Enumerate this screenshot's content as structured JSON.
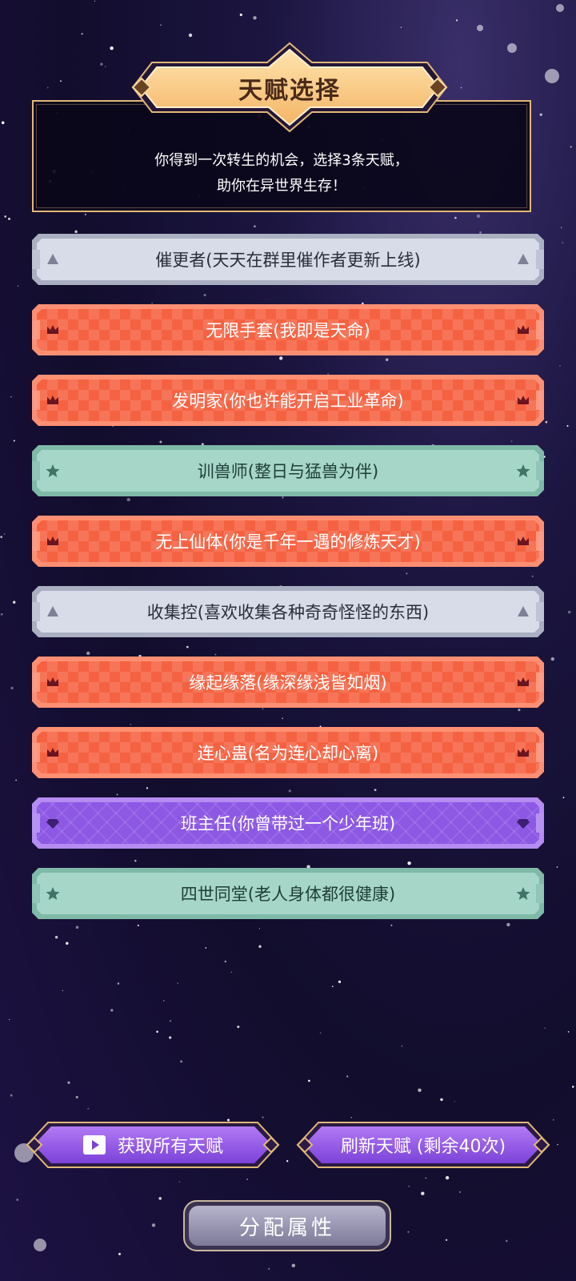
{
  "header": {
    "title": "天赋选择",
    "description_line1": "你得到一次转生的机会，选择3条天赋，",
    "description_line2": "助你在异世界生存！"
  },
  "talents": [
    {
      "label": "催更者(天天在群里催作者更新上线)",
      "rarity": "gray",
      "icon": "triangle-icon"
    },
    {
      "label": "无限手套(我即是天命)",
      "rarity": "red",
      "icon": "crown-icon"
    },
    {
      "label": "发明家(你也许能开启工业革命)",
      "rarity": "red",
      "icon": "crown-icon"
    },
    {
      "label": "训兽师(整日与猛兽为伴)",
      "rarity": "green",
      "icon": "star-icon"
    },
    {
      "label": "无上仙体(你是千年一遇的修炼天才)",
      "rarity": "red",
      "icon": "crown-icon"
    },
    {
      "label": "收集控(喜欢收集各种奇奇怪怪的东西)",
      "rarity": "gray",
      "icon": "triangle-icon"
    },
    {
      "label": "缘起缘落(缘深缘浅皆如烟)",
      "rarity": "red",
      "icon": "crown-icon"
    },
    {
      "label": "连心蛊(名为连心却心离)",
      "rarity": "red",
      "icon": "crown-icon"
    },
    {
      "label": "班主任(你曾带过一个少年班)",
      "rarity": "purple",
      "icon": "diamond-icon"
    },
    {
      "label": "四世同堂(老人身体都很健康)",
      "rarity": "green",
      "icon": "star-icon"
    }
  ],
  "actions": {
    "get_all_label": "获取所有天赋",
    "refresh_label": "刷新天赋 (剩余40次)",
    "assign_label": "分配属性"
  },
  "colors": {
    "gold": "#e0b778",
    "gray": "#d8dce8",
    "red": "#f56242",
    "green": "#a6d6c8",
    "purple": "#8c58e4"
  }
}
